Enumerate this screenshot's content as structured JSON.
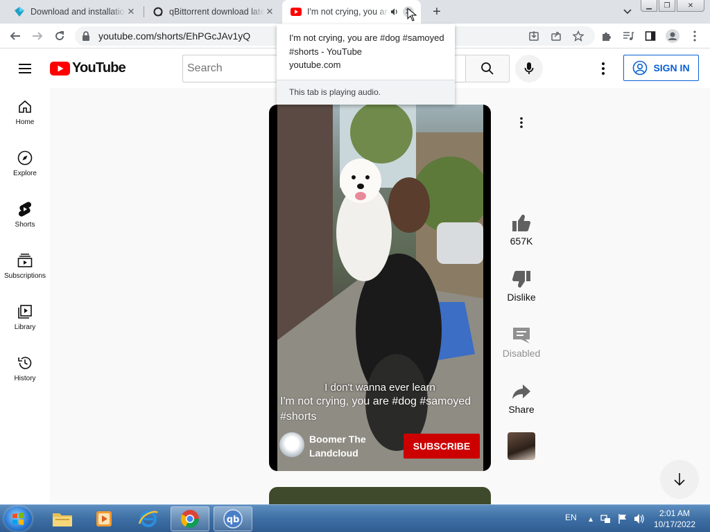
{
  "browser": {
    "tabs": [
      {
        "title": "Download and installation",
        "favicon": "blue-diamond-icon"
      },
      {
        "title": "qBittorrent download latest",
        "favicon": "qbittorrent-o-icon"
      },
      {
        "title": "I'm not crying, you are #dog",
        "favicon": "youtube-icon",
        "active": true,
        "audio": true
      }
    ],
    "url": "youtube.com/shorts/EhPGcJAv1yQ",
    "hovercard": {
      "title": "I'm not crying, you are #dog #samoyed #shorts - YouTube",
      "domain": "youtube.com",
      "audio_note": "This tab is playing audio."
    }
  },
  "youtube": {
    "logo_text": "YouTube",
    "search_placeholder": "Search",
    "sign_in": "SIGN IN",
    "guide": [
      {
        "label": "Home",
        "icon": "home-icon"
      },
      {
        "label": "Explore",
        "icon": "compass-icon"
      },
      {
        "label": "Shorts",
        "icon": "shorts-icon"
      },
      {
        "label": "Subscriptions",
        "icon": "subscriptions-icon"
      },
      {
        "label": "Library",
        "icon": "library-icon"
      },
      {
        "label": "History",
        "icon": "history-icon"
      }
    ],
    "short": {
      "caption": "I don't wanna ever learn",
      "title": "I'm not crying, you are #dog #samoyed #shorts",
      "channel": "Boomer The Landcloud",
      "subscribe": "SUBSCRIBE"
    },
    "actions": {
      "like": "657K",
      "dislike": "Dislike",
      "comments": "Disabled",
      "share": "Share"
    }
  },
  "taskbar": {
    "language": "EN",
    "time": "2:01 AM",
    "date": "10/17/2022"
  },
  "colors": {
    "youtube_red": "#ff0000",
    "subscribe_red": "#cc0000",
    "sign_in_blue": "#065fd4"
  }
}
